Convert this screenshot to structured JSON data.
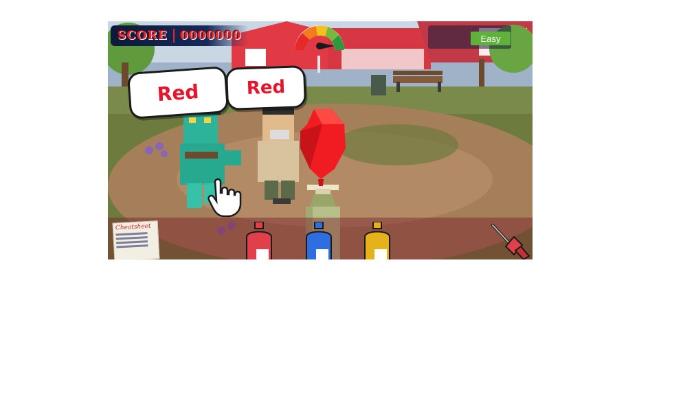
{
  "hud": {
    "score_label": "SCORE",
    "score_value": "0000000",
    "difficulty": "Easy"
  },
  "bubbles": [
    "Red",
    "Red"
  ],
  "toolbar": {
    "cheatsheet_title": "Cheatsheet",
    "paints": [
      {
        "name": "red-paint-can",
        "color": "#e0404a"
      },
      {
        "name": "blue-paint-can",
        "color": "#2e6ee0"
      },
      {
        "name": "yellow-paint-can",
        "color": "#e6b21c"
      }
    ],
    "accent_colors": {
      "score": "#e8232b",
      "difficulty": "#5fb13c",
      "balloon": "#f01c22"
    }
  }
}
